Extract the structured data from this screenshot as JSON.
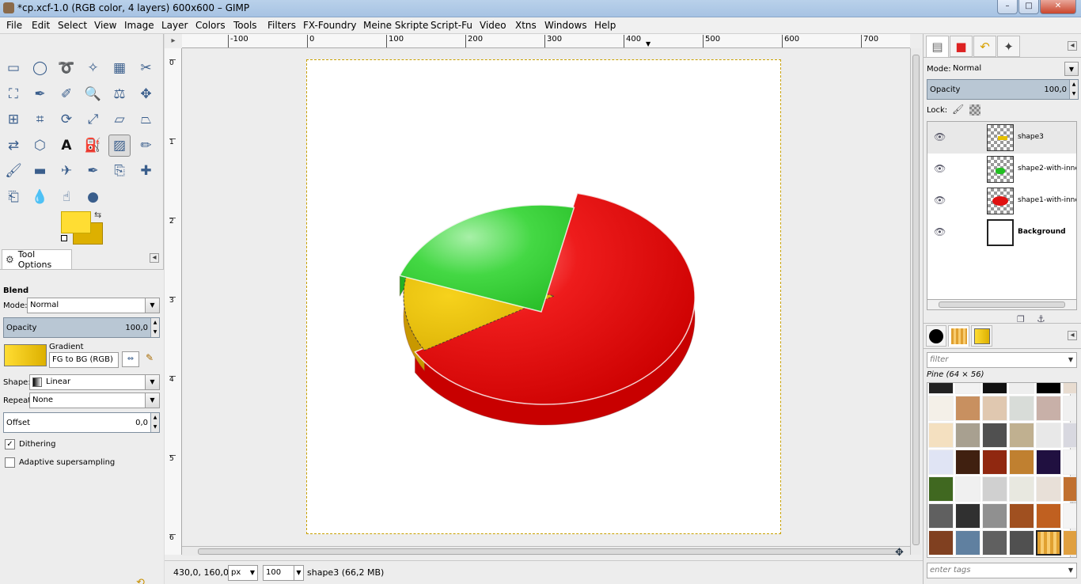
{
  "window": {
    "title": "*cp.xcf-1.0 (RGB color, 4 layers) 600x600 – GIMP",
    "minimize": "–",
    "maximize": "□",
    "close": "✕"
  },
  "menubar": [
    "File",
    "Edit",
    "Select",
    "View",
    "Image",
    "Layer",
    "Colors",
    "Tools",
    "Filters",
    "FX-Foundry",
    "Meine Skripte",
    "Script-Fu",
    "Video",
    "Xtns",
    "Windows",
    "Help"
  ],
  "toolbox": {
    "tools": [
      "rect-select",
      "ellipse-select",
      "free-select",
      "fuzzy-select",
      "select-by-color",
      "scissors",
      "foreground-select",
      "paths",
      "color-picker",
      "zoom",
      "measure",
      "move",
      "align",
      "crop",
      "rotate",
      "scale",
      "shear",
      "perspective",
      "flip",
      "cage",
      "text",
      "bucket-fill",
      "blend",
      "pencil",
      "paintbrush",
      "eraser",
      "airbrush",
      "ink",
      "clone",
      "heal",
      "perspective-clone",
      "blur",
      "smudge",
      "dodge-burn"
    ],
    "active_tool": "blend",
    "foreground_color": "#ffdd33",
    "background_color": "#ddb000"
  },
  "tool_options": {
    "tab_label": "Tool Options",
    "tool_name": "Blend",
    "mode_label": "Mode:",
    "mode_value": "Normal",
    "opacity_label": "Opacity",
    "opacity_value": "100,0",
    "gradient_label": "Gradient",
    "gradient_value": "FG to BG (RGB)",
    "shape_label": "Shape:",
    "shape_value": "Linear",
    "repeat_label": "Repeat:",
    "repeat_value": "None",
    "offset_label": "Offset",
    "offset_value": "0,0",
    "dithering_label": "Dithering",
    "dithering_checked": true,
    "adaptive_label": "Adaptive supersampling",
    "adaptive_checked": false
  },
  "rulers": {
    "horizontal": [
      "-100",
      "0",
      "100",
      "200",
      "300",
      "400",
      "500",
      "600",
      "700"
    ],
    "vertical": [
      "0",
      "1",
      "2",
      "3",
      "4",
      "5",
      "6"
    ]
  },
  "chart_data": {
    "type": "pie",
    "categories": [
      "red",
      "yellow",
      "green"
    ],
    "values": [
      63,
      14,
      23
    ],
    "colors": [
      "#dd0000",
      "#e0b800",
      "#33cc33"
    ],
    "title": "",
    "style": "3d"
  },
  "status": {
    "coords": "430,0, 160,0",
    "unit": "px",
    "zoom": "100",
    "layer_info": "shape3 (66,2 MB)"
  },
  "layers_panel": {
    "mode_label": "Mode:",
    "mode_value": "Normal",
    "opacity_label": "Opacity",
    "opacity_value": "100,0",
    "lock_label": "Lock:",
    "layers": [
      {
        "name": "shape3",
        "selected": true,
        "bold": false
      },
      {
        "name": "shape2-with-inne",
        "selected": false,
        "bold": false
      },
      {
        "name": "shape1-with-inne",
        "selected": false,
        "bold": false
      },
      {
        "name": "Background",
        "selected": false,
        "bold": true
      }
    ]
  },
  "patterns_panel": {
    "filter_placeholder": "filter",
    "pattern_name": "Pine (64 × 56)",
    "tags_placeholder": "enter tags"
  }
}
